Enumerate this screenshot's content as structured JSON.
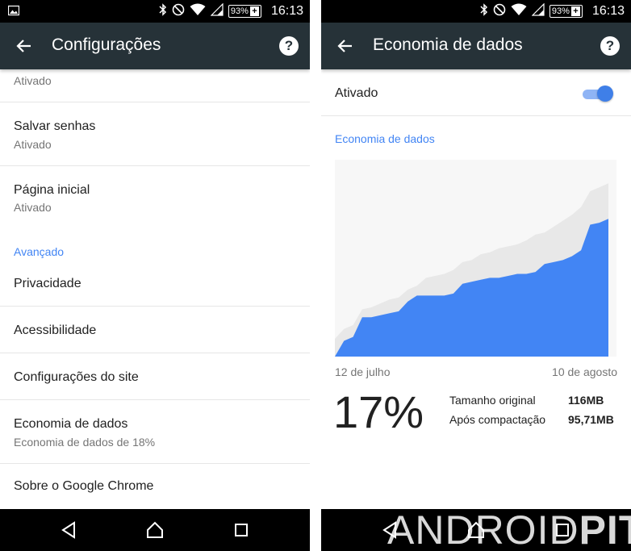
{
  "status_bar": {
    "time": "16:13",
    "battery": "93%"
  },
  "left_screen": {
    "title": "Configurações",
    "items": [
      {
        "subtitle": "Ativado"
      },
      {
        "title": "Salvar senhas",
        "subtitle": "Ativado"
      },
      {
        "title": "Página inicial",
        "subtitle": "Ativado"
      }
    ],
    "section_header": "Avançado",
    "advanced_items": [
      {
        "title": "Privacidade"
      },
      {
        "title": "Acessibilidade"
      },
      {
        "title": "Configurações do site"
      },
      {
        "title": "Economia de dados",
        "subtitle": "Economia de dados de 18%"
      },
      {
        "title": "Sobre o Google Chrome"
      }
    ]
  },
  "right_screen": {
    "title": "Economia de dados",
    "toggle_label": "Ativado",
    "toggle_on": true,
    "section_header": "Economia de dados",
    "chart_start_label": "12 de julho",
    "chart_end_label": "10 de agosto",
    "savings_percent": "17%",
    "stats": [
      {
        "label": "Tamanho original",
        "value": "116MB"
      },
      {
        "label": "Após compactação",
        "value": "95,71MB"
      }
    ]
  },
  "watermark": {
    "part1": "ANDROID",
    "part2": "PIT"
  },
  "colors": {
    "appbar": "#263238",
    "accent": "#4285f4",
    "original_area": "#e8e8e8",
    "compressed_area": "#4285f4"
  },
  "chart_data": {
    "type": "area",
    "x_labels": [
      "12 de julho",
      "10 de agosto"
    ],
    "ylim": [
      0,
      100
    ],
    "series": [
      {
        "values": [
          9,
          14,
          16,
          24,
          25,
          27,
          29,
          30,
          34,
          36,
          40,
          41,
          42,
          44,
          48,
          49,
          52,
          53,
          55,
          56,
          57,
          59,
          62,
          63,
          66,
          69,
          72,
          76,
          84,
          86,
          88
        ]
      },
      {
        "values": [
          0,
          8,
          10,
          20,
          20,
          21,
          22,
          23,
          28,
          31,
          31,
          31,
          31,
          32,
          37,
          38,
          39,
          40,
          40,
          41,
          42,
          42,
          43,
          47,
          48,
          49,
          51,
          54,
          67,
          68,
          70
        ]
      }
    ]
  }
}
